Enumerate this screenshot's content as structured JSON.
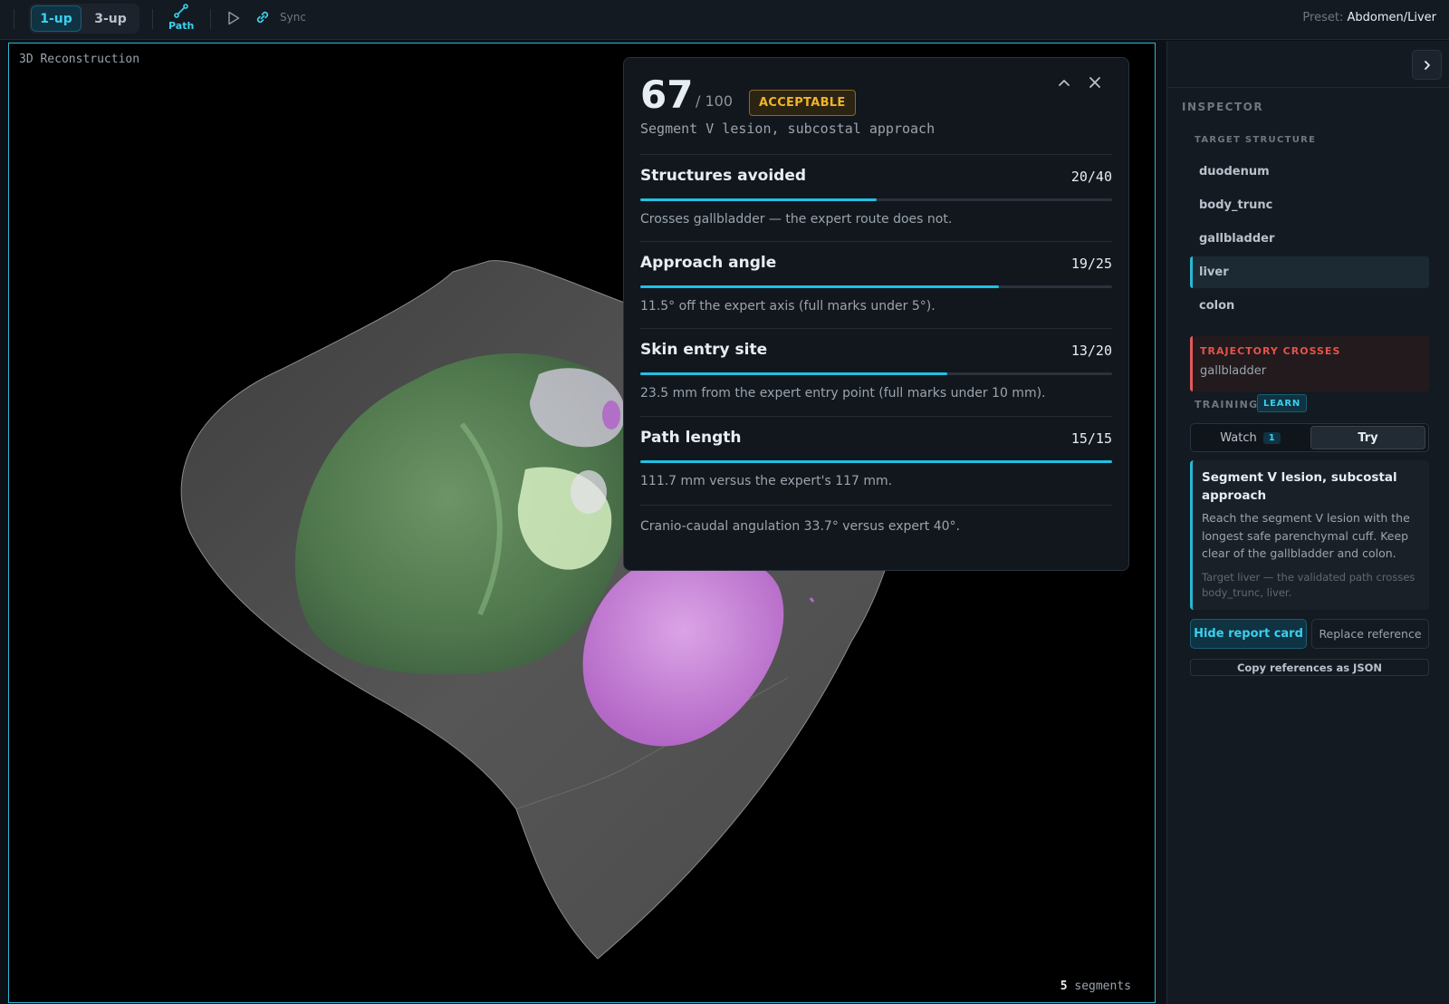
{
  "toolbar": {
    "layout_1up": "1-up",
    "layout_3up": "3-up",
    "path_label": "Path",
    "sync_label": "Sync",
    "preset_label": "Preset:",
    "preset_value": "Abdomen/Liver"
  },
  "viewport": {
    "title": "3D Reconstruction",
    "segment_count": "5",
    "segment_label": "segments"
  },
  "report": {
    "score": "67",
    "score_max": "/ 100",
    "rating": "ACCEPTABLE",
    "subtitle": "Segment V lesion, subcostal approach",
    "criteria": [
      {
        "name": "Structures avoided",
        "score": "20/40",
        "fraction": 0.5,
        "note": "Crosses gallbladder — the expert route does not."
      },
      {
        "name": "Approach angle",
        "score": "19/25",
        "fraction": 0.76,
        "note": "11.5° off the expert axis (full marks under 5°)."
      },
      {
        "name": "Skin entry site",
        "score": "13/20",
        "fraction": 0.65,
        "note": "23.5 mm from the expert entry point (full marks under 10 mm)."
      },
      {
        "name": "Path length",
        "score": "15/15",
        "fraction": 1.0,
        "note": "111.7 mm versus the expert's 117 mm."
      }
    ],
    "extra_note": "Cranio-caudal angulation 33.7° versus expert 40°."
  },
  "inspector": {
    "heading": "INSPECTOR",
    "target_heading": "TARGET STRUCTURE",
    "structures": [
      "duodenum",
      "body_trunc",
      "gallbladder",
      "liver",
      "colon"
    ],
    "selected_structure": "liver",
    "crosses_heading": "TRAJECTORY CROSSES",
    "crosses_value": "gallbladder",
    "training_label": "TRAINING",
    "training_badge": "LEARN",
    "watch_label": "Watch",
    "watch_count": "1",
    "try_label": "Try",
    "lesson_title": "Segment V lesion, subcostal approach",
    "lesson_body": "Reach the segment V lesion with the longest safe parenchymal cuff. Keep clear of the gallbladder and colon.",
    "lesson_note": "Target liver — the validated path crosses body_trunc, liver.",
    "hide_button": "Hide report card",
    "replace_button": "Replace reference",
    "copy_button": "Copy references as JSON"
  },
  "colors": {
    "accent": "#28b8d6",
    "warning": "#f0b429",
    "danger": "#e5534b",
    "liver": "#4f7a4c",
    "colon": "#c77ad8",
    "body": "#5a5a5a"
  },
  "icons": [
    "path-icon",
    "play-icon",
    "link-icon",
    "chevron-up-icon",
    "close-icon",
    "chevron-right-icon"
  ]
}
